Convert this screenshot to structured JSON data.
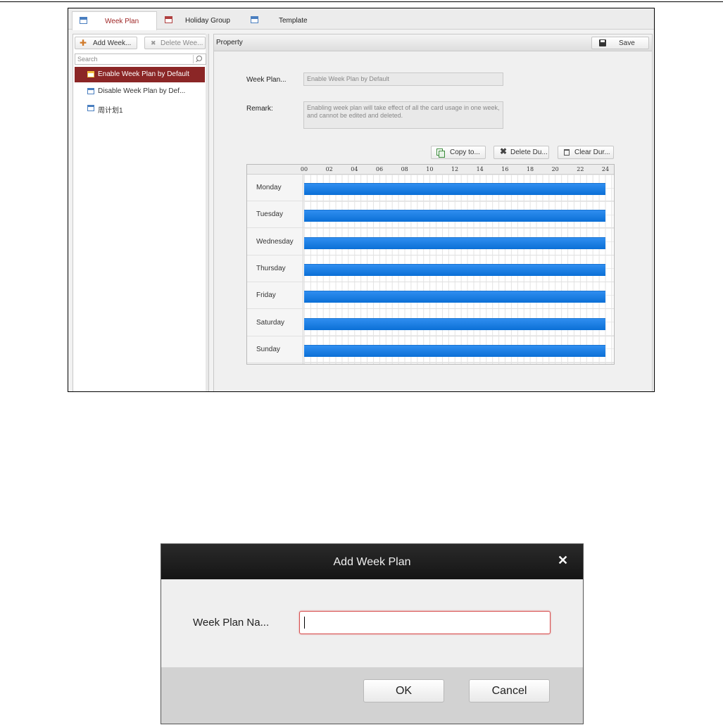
{
  "tabs": [
    {
      "label": "Week Plan",
      "active": true
    },
    {
      "label": "Holiday Group",
      "active": false
    },
    {
      "label": "Template",
      "active": false
    }
  ],
  "toolbar": {
    "add_label": "Add Week...",
    "delete_label": "Delete Wee..."
  },
  "search": {
    "placeholder": "Search"
  },
  "plans": [
    {
      "label": "Enable Week Plan by Default",
      "selected": true
    },
    {
      "label": "Disable Week Plan by Def...",
      "selected": false
    },
    {
      "label": "周计划1",
      "selected": false
    }
  ],
  "property": {
    "title": "Property",
    "save_label": "Save",
    "week_plan_label": "Week Plan...",
    "week_plan_value": "Enable Week Plan by Default",
    "remark_label": "Remark:",
    "remark_value": "Enabling week plan will take effect of all the card usage in one week, and cannot be edited and deleted."
  },
  "actions": {
    "copy_label": "Copy to...",
    "delete_label": "Delete Du...",
    "clear_label": "Clear Dur..."
  },
  "schedule": {
    "hours": [
      "00",
      "02",
      "04",
      "06",
      "08",
      "10",
      "12",
      "14",
      "16",
      "18",
      "20",
      "22",
      "24"
    ],
    "days": [
      {
        "name": "Monday",
        "start": 0,
        "end": 24
      },
      {
        "name": "Tuesday",
        "start": 0,
        "end": 24
      },
      {
        "name": "Wednesday",
        "start": 0,
        "end": 24
      },
      {
        "name": "Thursday",
        "start": 0,
        "end": 24
      },
      {
        "name": "Friday",
        "start": 0,
        "end": 24
      },
      {
        "name": "Saturday",
        "start": 0,
        "end": 24
      },
      {
        "name": "Sunday",
        "start": 0,
        "end": 24
      }
    ],
    "bar_color": "#0b6fd6"
  },
  "dialog": {
    "title": "Add Week Plan",
    "name_label": "Week Plan Na...",
    "name_value": "",
    "ok_label": "OK",
    "cancel_label": "Cancel"
  },
  "colors": {
    "selected_item": "#8b2626",
    "active_tab_text": "#a02828"
  }
}
